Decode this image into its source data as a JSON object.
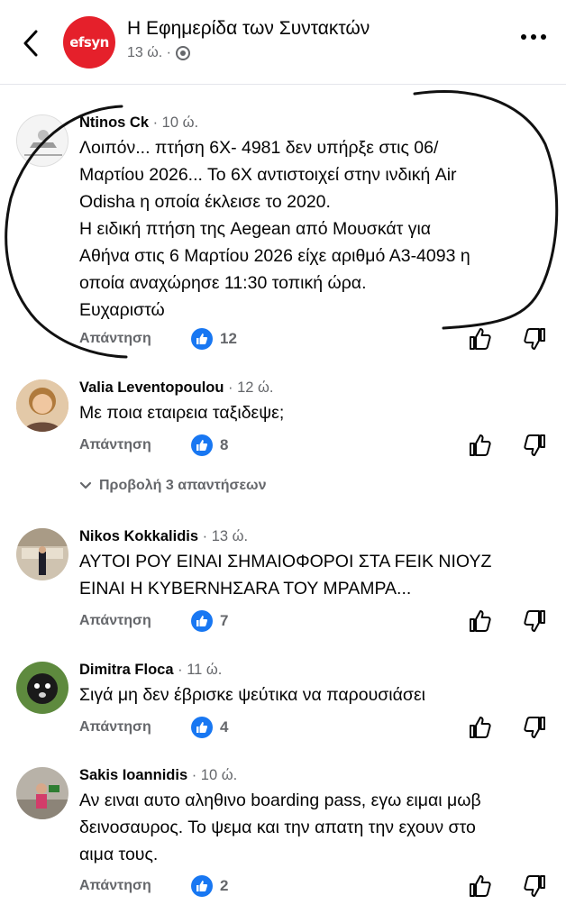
{
  "header": {
    "page_name": "Η Εφημερίδα των Συντακτών",
    "logo_text": "efsyn",
    "time": "13 ώ. ·",
    "brand_color": "#e5202b"
  },
  "comments": [
    {
      "author": "Ntinos Ck",
      "time": " · 10 ώ.",
      "text": "Λοιπόν... πτήση 6Χ- 4981 δεν υπήρξε στις 06/\nΜαρτίου 2026... Το 6Χ αντιστοιχεί στην ινδική Air\nOdisha  η οποία έκλεισε το 2020.\nΗ ειδική πτήση της Aegean από Μουσκάτ για\nΑθήνα στις 6 Μαρτίου 2026 είχε αριθμό Α3-4093 η\nοποία αναχώρησε 11:30 τοπική ώρα.\nΕυχαριστώ",
      "reply_label": "Απάντηση",
      "likes": "12"
    },
    {
      "author": "Valia Leventopoulou",
      "time": " · 12 ώ.",
      "text": "Με ποια εταιρεια ταξιδεψε;",
      "reply_label": "Απάντηση",
      "likes": "8"
    },
    {
      "author": "Nikos Kokkalidis",
      "time": " · 13 ώ.",
      "text": "ΑΥΤΟΙ ΡΟΥ ΕΙΝΑΙ ΣΗΜΑΙΟΦΟΡΟΙ ΣΤΑ FΕΙΚ ΝΙΟΥΖ\nΕΙΝΑΙ Η ΚΥΒΕRΝΗΣΑRΑ ΤΟΥ ΜΡΑΜΡΑ...",
      "reply_label": "Απάντηση",
      "likes": "7"
    },
    {
      "author": "Dimitra Floca",
      "time": " · 11 ώ.",
      "text": "Σιγά μη δεν έβρισκε ψεύτικα να παρουσιάσει",
      "reply_label": "Απάντηση",
      "likes": "4"
    },
    {
      "author": "Sakis Ioannidis",
      "time": " · 10 ώ.",
      "text": "Αν ειναι αυτο αληθινο boarding pass, εγω ειμαι μωβ\nδεινοσαυρος. Το ψεμα και την απατη την εχουν στο\nαιμα τους.",
      "reply_label": "Απάντηση",
      "likes": "2"
    }
  ],
  "view_replies": "Προβολή 3 απαντήσεων",
  "icons": [
    "back-arrow-icon",
    "globe-icon",
    "more-icon",
    "like-badge-icon",
    "thumbs-up-icon",
    "thumbs-down-icon",
    "chevron-down-icon"
  ],
  "colors": {
    "accent": "#1877f2",
    "secondary_text": "#65676b",
    "scribble": "#111111"
  }
}
